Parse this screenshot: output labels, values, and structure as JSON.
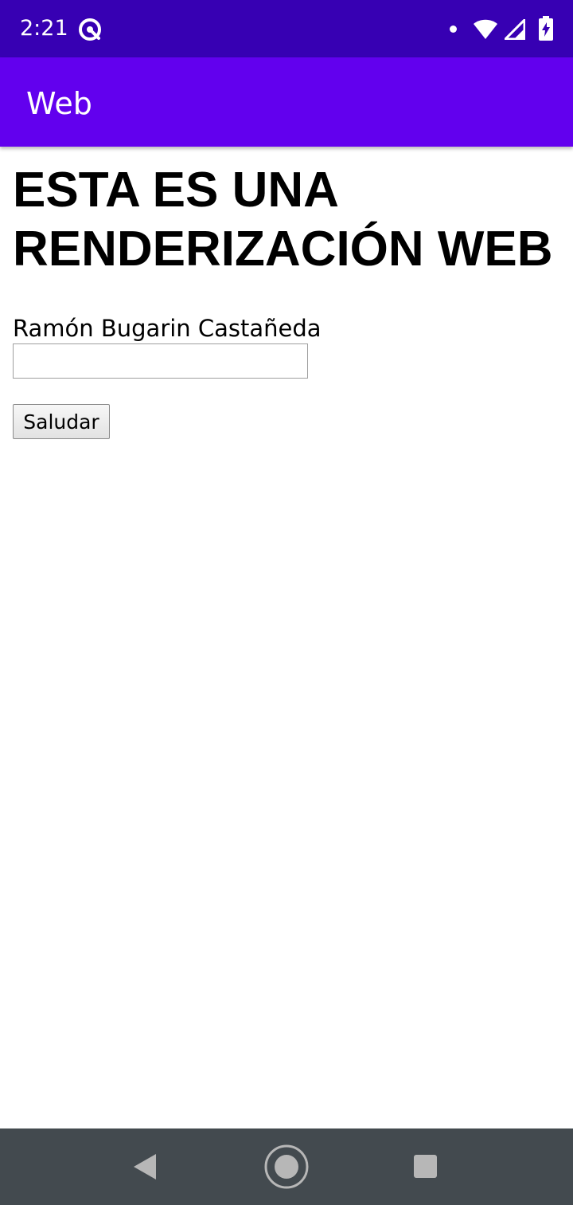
{
  "status_bar": {
    "time": "2:21",
    "icons": [
      "app-notification-icon",
      "notification-dot-icon",
      "wifi-icon",
      "cell-signal-icon",
      "battery-charging-icon"
    ]
  },
  "app_bar": {
    "title": "Web",
    "color": "#6200ee"
  },
  "colors": {
    "status_bar": "#3700b3",
    "app_bar": "#6200ee",
    "nav_bar": "#434a4f"
  },
  "web_page": {
    "heading": "ESTA ES UNA RENDERIZACIÓN WEB",
    "label": "Ramón Bugarin Castañeda",
    "input": {
      "value": "",
      "placeholder": ""
    },
    "button_label": "Saludar"
  },
  "nav_bar": {
    "icons": [
      "back-icon",
      "home-icon",
      "recents-icon"
    ]
  }
}
